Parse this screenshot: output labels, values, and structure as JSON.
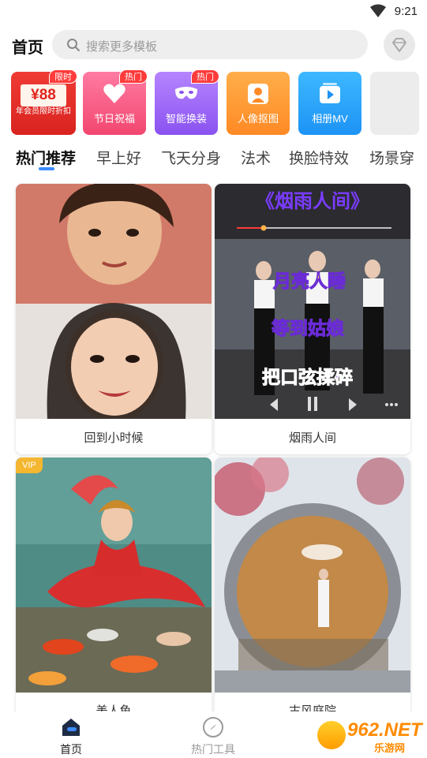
{
  "status_bar": {
    "time": "9:21"
  },
  "header": {
    "title": "首页",
    "search_placeholder": "搜索更多模板"
  },
  "features": [
    {
      "price": "¥88",
      "label": "年会员限时折扣",
      "tag": "限时"
    },
    {
      "label": "节日祝福",
      "tag": "热门"
    },
    {
      "label": "智能换装",
      "tag": "热门"
    },
    {
      "label": "人像抠图",
      "tag": ""
    },
    {
      "label": "相册MV",
      "tag": ""
    }
  ],
  "tabs": [
    "热门推荐",
    "早上好",
    "飞天分身",
    "法术",
    "换脸特效",
    "场景穿"
  ],
  "active_tab": "热门推荐",
  "cards": [
    {
      "label": "回到小时候",
      "vip": ""
    },
    {
      "label": "烟雨人间",
      "vip": "",
      "video_title": "《烟雨人间》",
      "lyrics": [
        "月亮人睡",
        "等到姑娘",
        "把口弦揉碎"
      ]
    },
    {
      "label": "美人鱼",
      "vip": "VIP"
    },
    {
      "label": "古风庭院",
      "vip": ""
    }
  ],
  "bottom_nav": {
    "home": "首页",
    "tools": "热门工具"
  },
  "watermark": {
    "main": "962.NET",
    "sub": "乐游网"
  }
}
